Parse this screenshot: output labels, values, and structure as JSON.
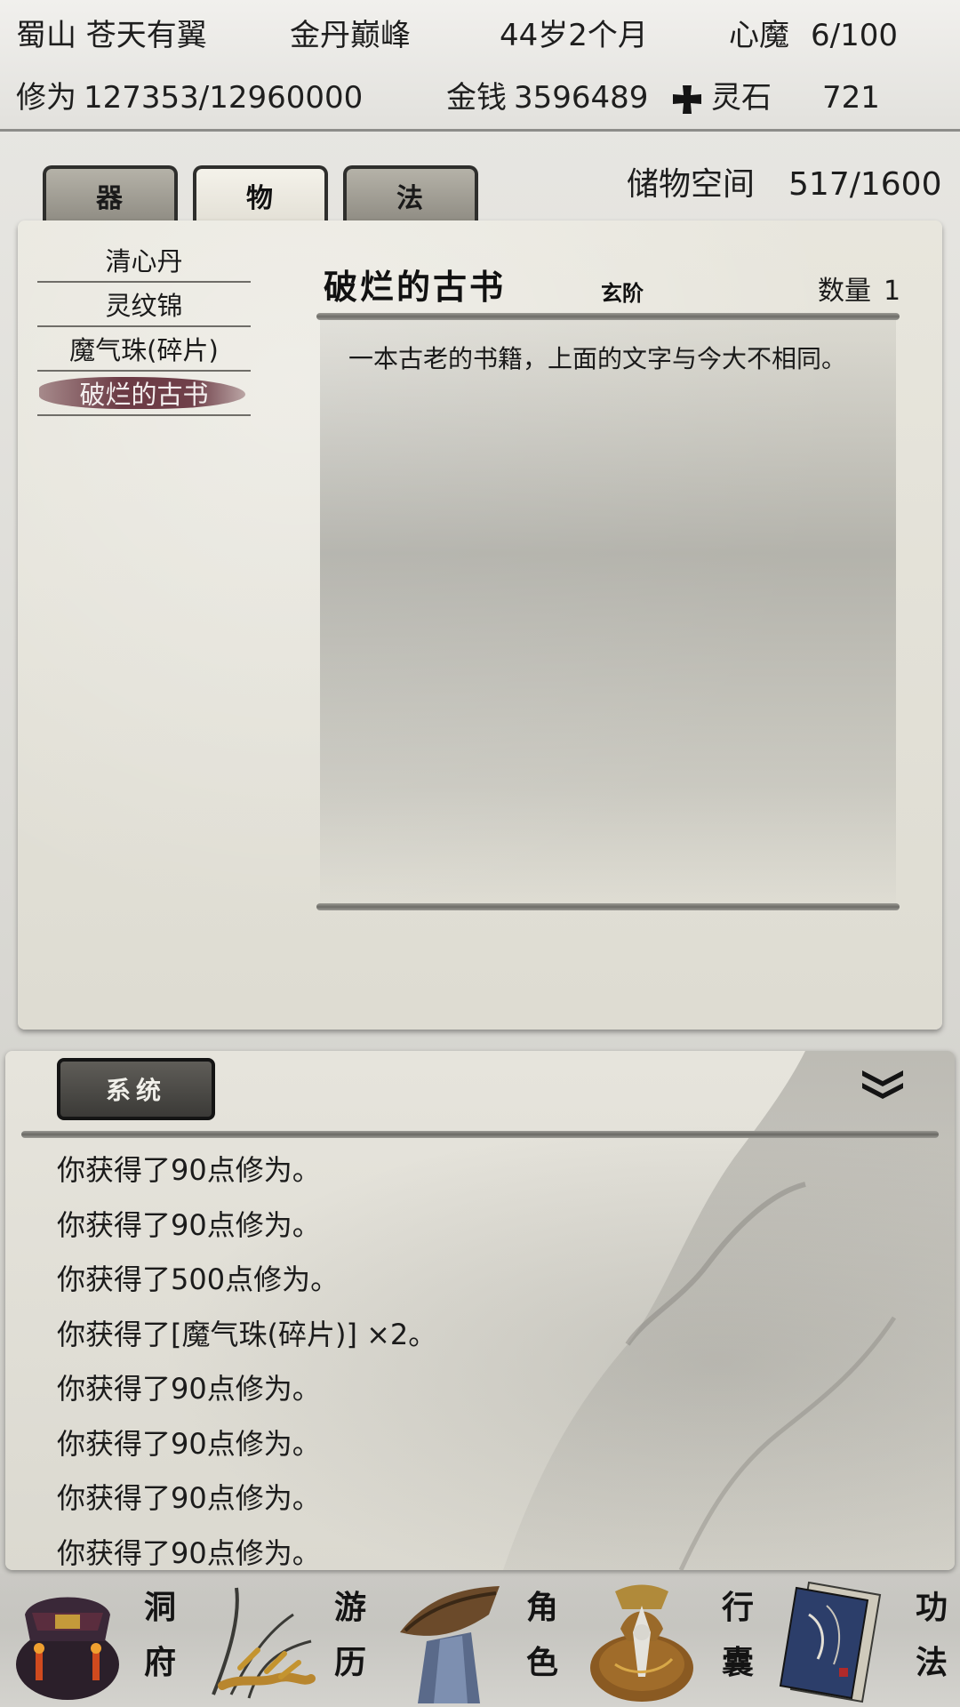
{
  "status": {
    "location": "蜀山 苍天有翼",
    "realm": "金丹巅峰",
    "age": "44岁2个月",
    "heart_demon_label": "心魔",
    "heart_demon_value": "6/100",
    "cultivation_label": "修为",
    "cultivation_value": "127353/12960000",
    "money_label": "金钱",
    "money_value": "3596489",
    "spirit_stone_label": "灵石",
    "spirit_stone_value": "721"
  },
  "tabs": [
    {
      "label": "器",
      "active": false
    },
    {
      "label": "物",
      "active": true
    },
    {
      "label": "法",
      "active": false
    }
  ],
  "storage": {
    "label": "储物空间",
    "value": "517/1600"
  },
  "items": [
    {
      "name": "清心丹"
    },
    {
      "name": "灵纹锦"
    },
    {
      "name": "魔气珠(碎片)"
    },
    {
      "name": "破烂的古书",
      "selected": true
    }
  ],
  "detail": {
    "name": "破烂的古书",
    "grade": "玄阶",
    "quantity_label": "数量",
    "quantity": "1",
    "description": "一本古老的书籍，上面的文字与今大不相同。"
  },
  "log": {
    "tab_label": "系统",
    "lines": [
      "你获得了90点修为。",
      "你获得了90点修为。",
      "你获得了500点修为。",
      "你获得了[魔气珠(碎片)] ×2。",
      "你获得了90点修为。",
      "你获得了90点修为。",
      "你获得了90点修为。",
      "你获得了90点修为。"
    ]
  },
  "nav": [
    {
      "label_top": "洞",
      "label_bottom": "府",
      "icon": "cave-dwelling-icon"
    },
    {
      "label_top": "游",
      "label_bottom": "历",
      "icon": "travel-icon"
    },
    {
      "label_top": "角",
      "label_bottom": "色",
      "icon": "character-icon"
    },
    {
      "label_top": "行",
      "label_bottom": "囊",
      "icon": "bag-icon"
    },
    {
      "label_top": "功",
      "label_bottom": "法",
      "icon": "technique-book-icon"
    }
  ],
  "colors": {
    "selected_item": "#6b3a44",
    "system_button": "#4a4945",
    "background": "#e4e2da"
  }
}
